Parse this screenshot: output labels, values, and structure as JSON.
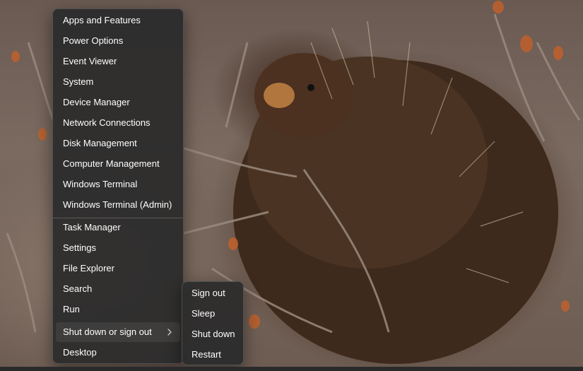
{
  "menu": {
    "items": [
      {
        "label": "Apps and Features"
      },
      {
        "label": "Power Options"
      },
      {
        "label": "Event Viewer"
      },
      {
        "label": "System"
      },
      {
        "label": "Device Manager"
      },
      {
        "label": "Network Connections"
      },
      {
        "label": "Disk Management"
      },
      {
        "label": "Computer Management"
      },
      {
        "label": "Windows Terminal"
      },
      {
        "label": "Windows Terminal (Admin)"
      },
      {
        "label": "Task Manager"
      },
      {
        "label": "Settings"
      },
      {
        "label": "File Explorer"
      },
      {
        "label": "Search"
      },
      {
        "label": "Run"
      },
      {
        "label": "Shut down or sign out",
        "submenu_icon": "chevron-right-icon",
        "expanded": true
      },
      {
        "label": "Desktop"
      }
    ]
  },
  "submenu": {
    "items": [
      {
        "label": "Sign out"
      },
      {
        "label": "Sleep"
      },
      {
        "label": "Shut down"
      },
      {
        "label": "Restart"
      }
    ]
  },
  "colors": {
    "menu_background": "#2c2c2c",
    "menu_text": "#ffffff",
    "separator": "#6e6e6e"
  }
}
